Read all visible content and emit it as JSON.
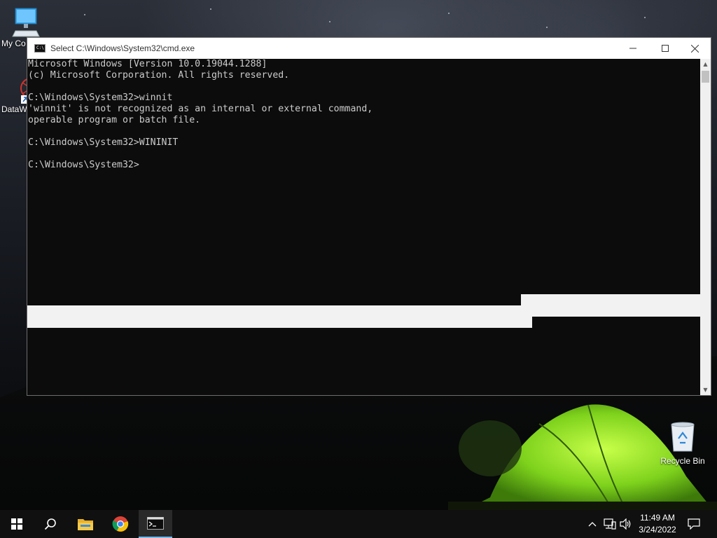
{
  "desktop": {
    "icons": [
      {
        "label": "My Co"
      },
      {
        "label": "DataW"
      },
      {
        "label": "Recycle Bin"
      }
    ]
  },
  "window": {
    "title": "Select C:\\Windows\\System32\\cmd.exe",
    "console_lines": [
      "Microsoft Windows [Version 10.0.19044.1288]",
      "(c) Microsoft Corporation. All rights reserved.",
      "",
      "C:\\Windows\\System32>winnit",
      "'winnit' is not recognized as an internal or external command,",
      "operable program or batch file.",
      "",
      "C:\\Windows\\System32>WININIT",
      "",
      "C:\\Windows\\System32>"
    ]
  },
  "taskbar": {
    "clock_time": "11:49 AM",
    "clock_date": "3/24/2022"
  },
  "colors": {
    "console_bg": "#0c0c0c",
    "console_text": "#cccccc",
    "selection": "#f2f2f2",
    "taskbar_bg": "#101010",
    "active_indicator": "#76b9ed"
  }
}
